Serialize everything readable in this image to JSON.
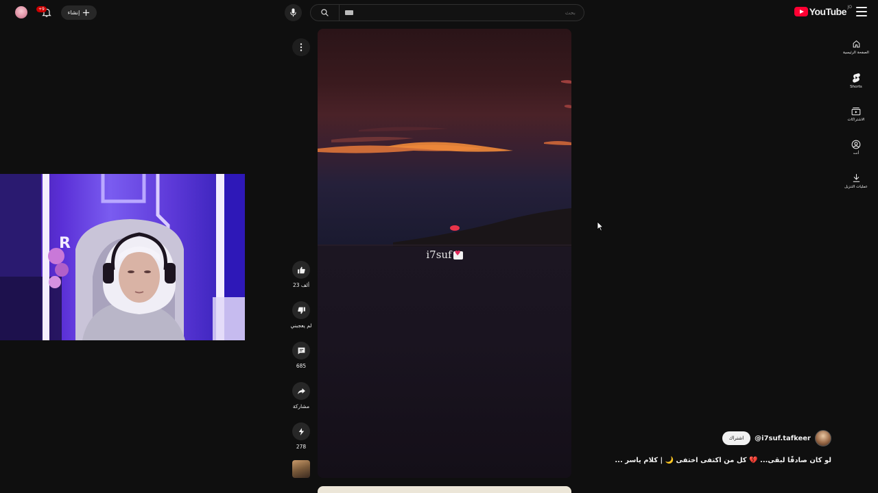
{
  "header": {
    "logo_text": "YouTube",
    "logo_country": "JO",
    "search_placeholder": "بحث",
    "create_label": "إنشاء",
    "notifications_badge": "+9"
  },
  "sidebar": {
    "items": [
      {
        "label": "الصفحة الرئيسية",
        "icon": "home-icon"
      },
      {
        "label": "Shorts",
        "icon": "shorts-icon"
      },
      {
        "label": "الاشتراكات",
        "icon": "subscriptions-icon"
      },
      {
        "label": "أنت",
        "icon": "you-icon"
      },
      {
        "label": "عمليات التنزيل",
        "icon": "download-icon"
      }
    ]
  },
  "video": {
    "watermark": "i7suf"
  },
  "actions": {
    "likes": "23 ألف",
    "dislike_label": "لم يعجبني",
    "comments": "685",
    "share_label": "مشاركة",
    "remix_count": "278"
  },
  "channel": {
    "handle": "@i7suf.tafkeer",
    "subscribe_label": "اشتراك"
  },
  "short_title": "لو كان صادقًا لبقى... 💔 كل من اكتفى اختفى 🌙 | كلام ياسر ...",
  "colors": {
    "background": "#0f0f0f",
    "brand_red": "#ff0033",
    "chip": "#272727"
  }
}
